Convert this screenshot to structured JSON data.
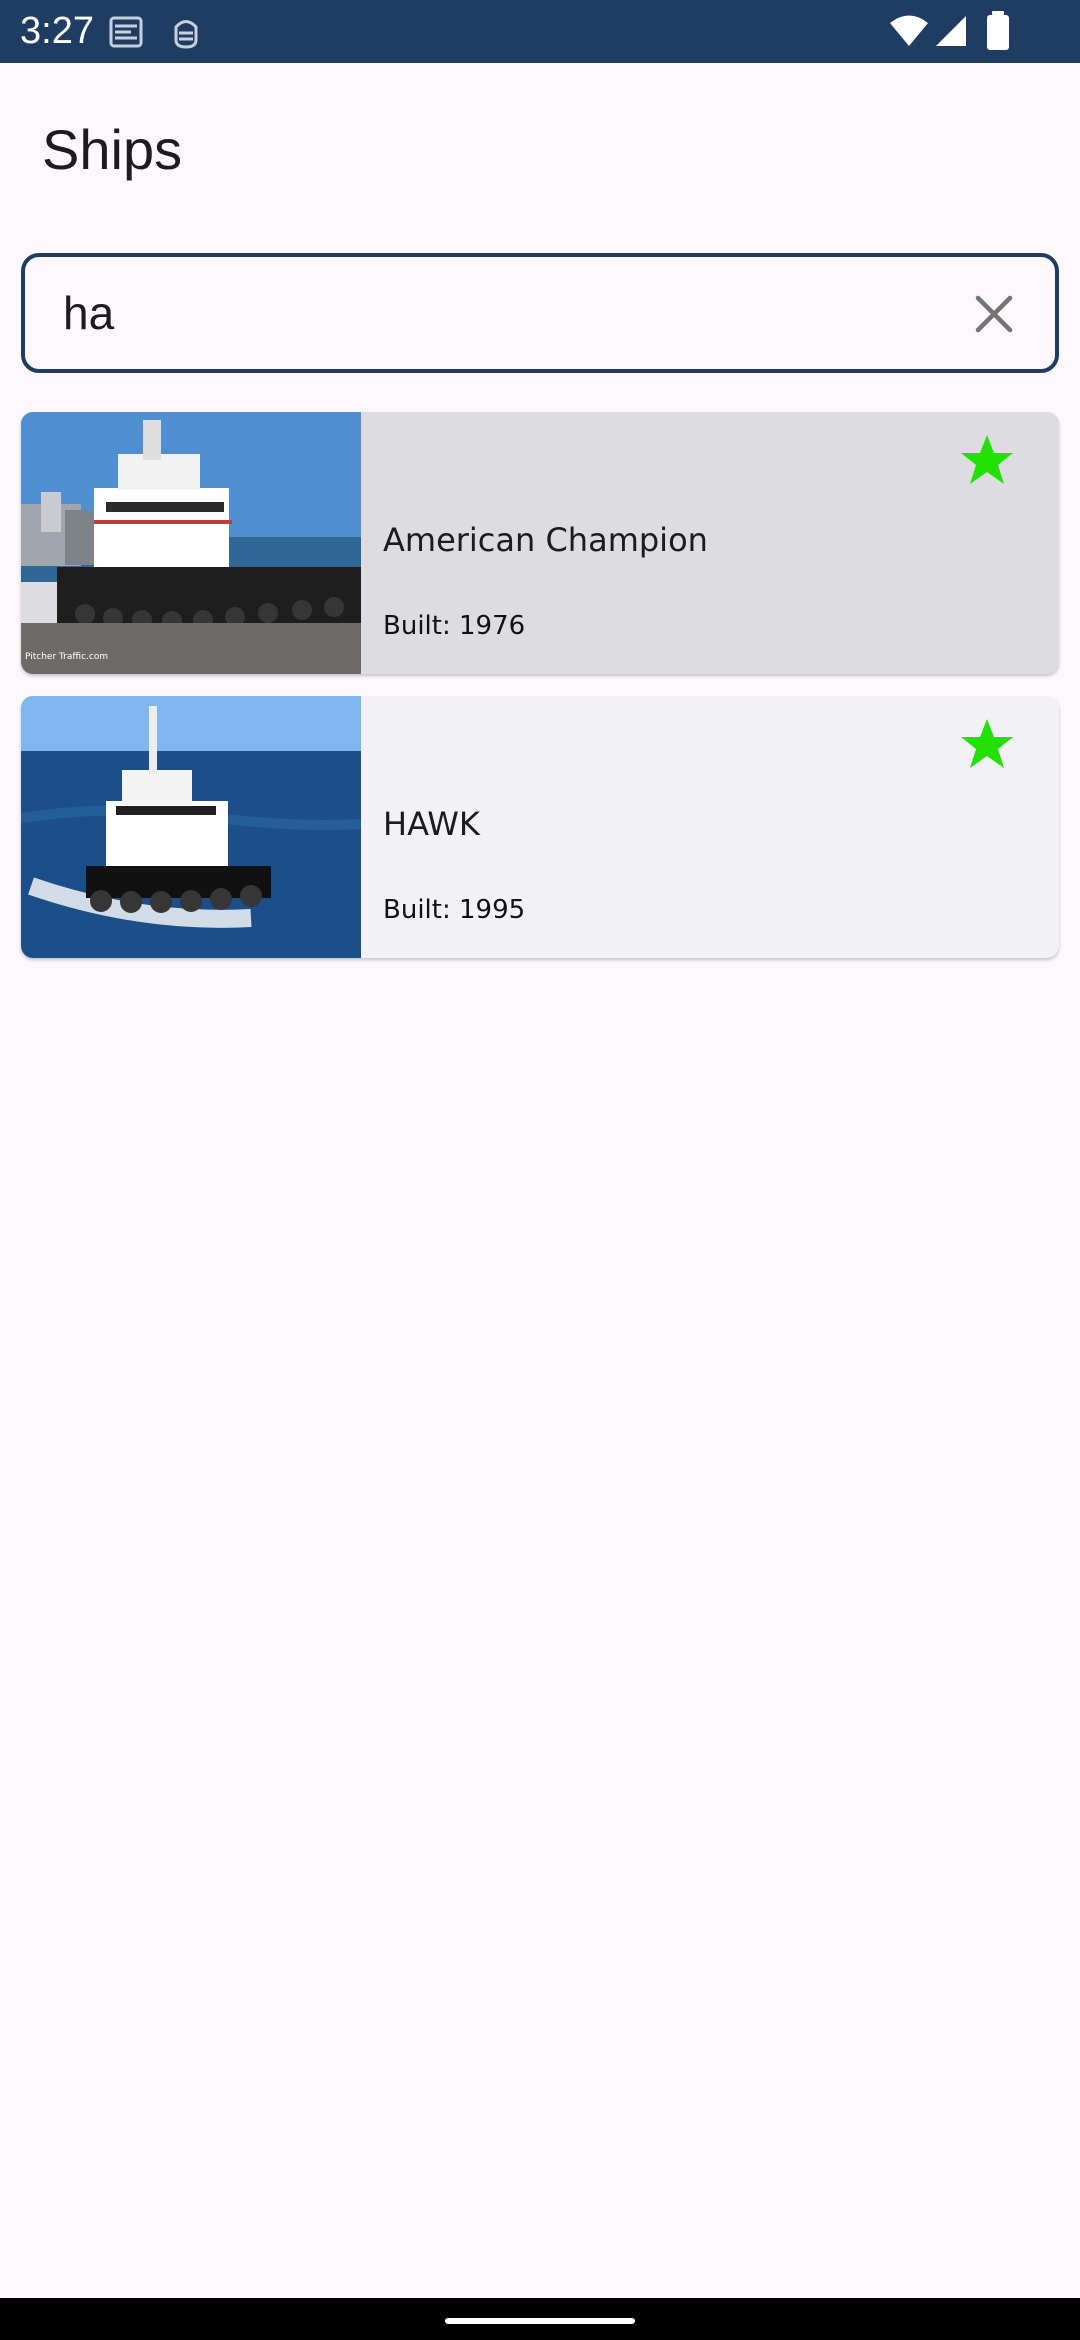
{
  "status_bar": {
    "time": "3:27",
    "icons": [
      "usb-debug-icon",
      "android-debug-icon",
      "wifi-icon",
      "cellular-signal-icon",
      "battery-icon"
    ],
    "background": "#1f3c63"
  },
  "app": {
    "title": "Ships"
  },
  "search": {
    "value": "ha",
    "clear_icon": "close-icon",
    "border_color": "#1f3c63"
  },
  "ships": [
    {
      "name": "American Champion",
      "built": "Built: 1976",
      "favorite": true,
      "favorite_icon": "star-icon",
      "image_text": "Pitcher Traffic.com"
    },
    {
      "name": "HAWK",
      "built": "Built: 1995",
      "favorite": true,
      "favorite_icon": "star-icon"
    }
  ],
  "colors": {
    "favorite_star": "#22e000",
    "selected_card": "#dddce1",
    "card": "#f2f1f5",
    "page_background": "#fdf8fc"
  }
}
